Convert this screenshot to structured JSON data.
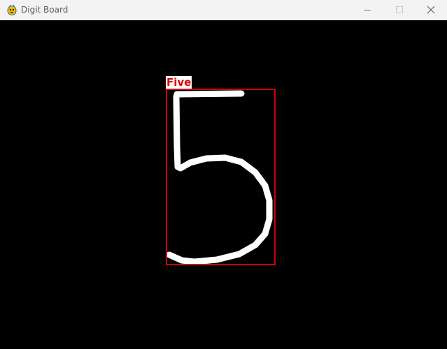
{
  "window": {
    "title": "Digit Board",
    "app_icon": "pygame-snake-icon",
    "controls": [
      "minimize-icon",
      "maximize-icon",
      "close-icon"
    ]
  },
  "canvas": {
    "background": "#000000",
    "stroke_color": "#ffffff",
    "detection": {
      "label": "Five",
      "box_color": "#d40000",
      "label_bg": "#ffffff",
      "label_color": "#e00000"
    }
  }
}
